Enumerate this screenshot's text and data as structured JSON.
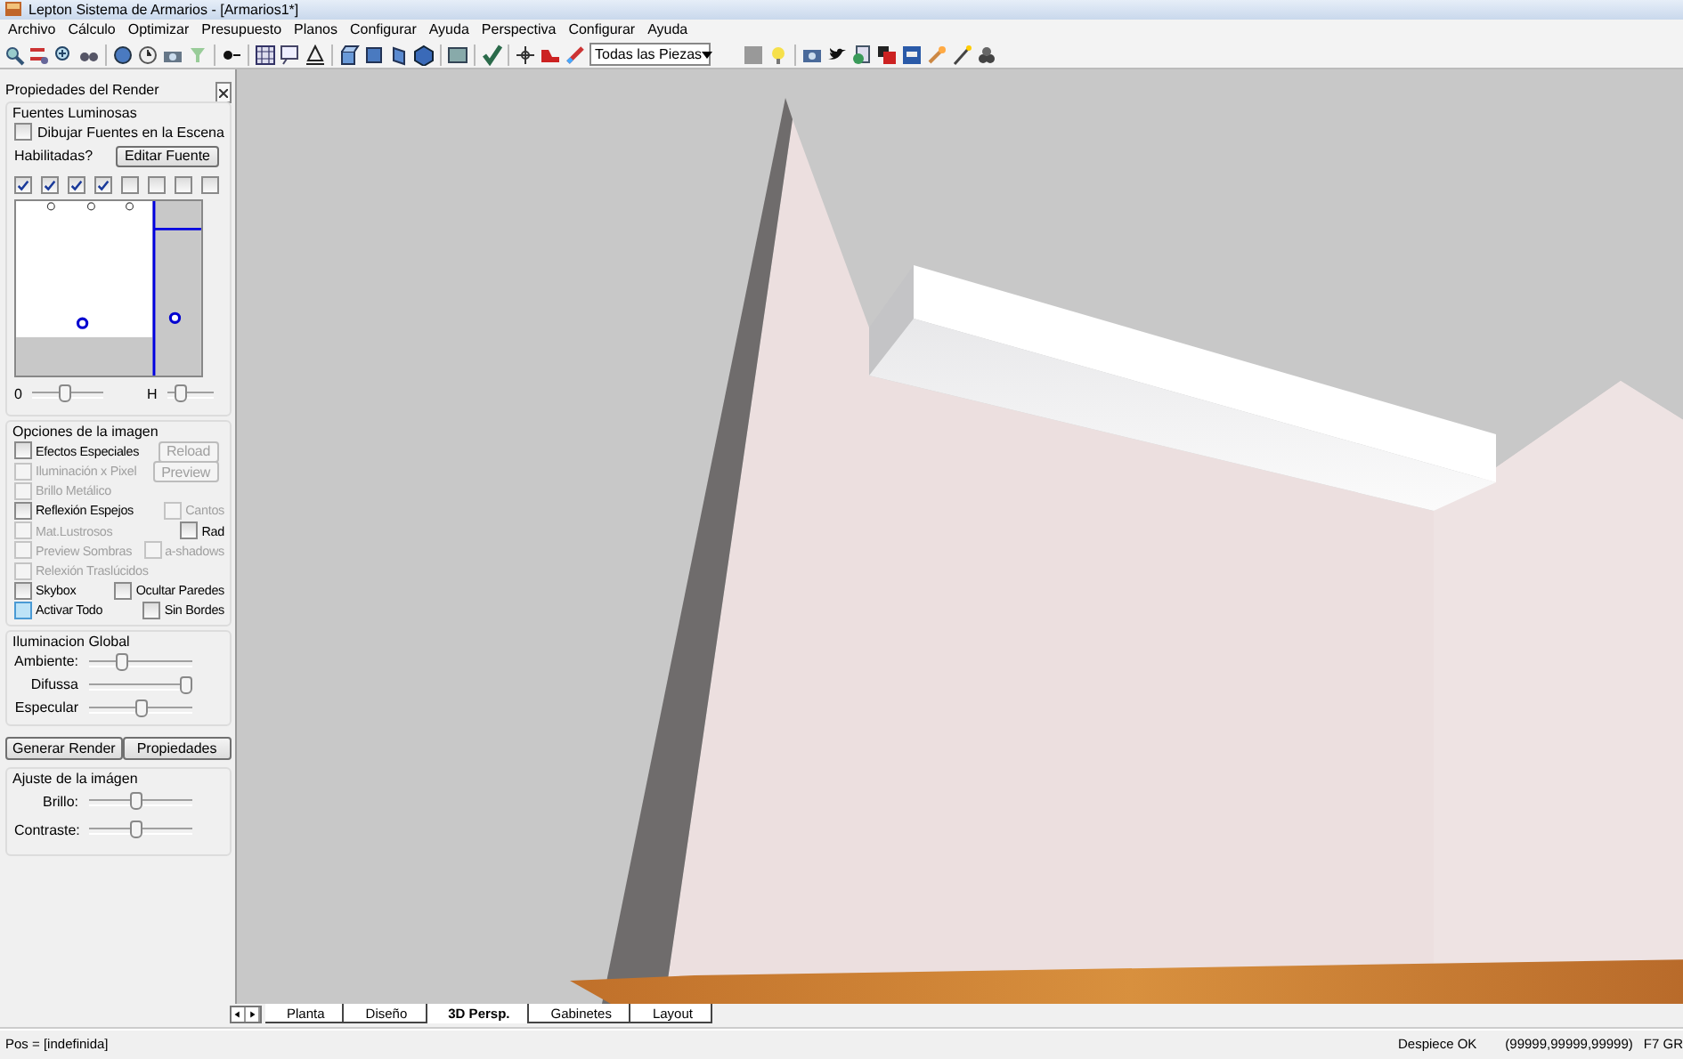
{
  "window": {
    "title": "Lepton Sistema de Armarios - [Armarios1*]"
  },
  "menu": [
    "Archivo",
    "Cálculo",
    "Optimizar",
    "Presupuesto",
    "Planos",
    "Configurar",
    "Ayuda",
    "Perspectiva",
    "Configurar",
    "Ayuda"
  ],
  "toolbar": {
    "pieces_dropdown": {
      "value": "Todas las Piezas"
    }
  },
  "render_panel": {
    "title": "Propiedades del Render",
    "light_sources": {
      "title": "Fuentes Luminosas",
      "draw_in_scene": {
        "label": "Dibujar Fuentes en la Escena",
        "checked": false
      },
      "edit_button": "Editar Fuente",
      "enabled_label": "Habilitadas?",
      "enabled": [
        {
          "checked": true
        },
        {
          "checked": true
        },
        {
          "checked": true
        },
        {
          "checked": true
        },
        {
          "checked": false
        },
        {
          "checked": false
        },
        {
          "checked": false
        },
        {
          "checked": false
        }
      ]
    },
    "sliders": [
      {
        "label": "0",
        "level": 0.45
      },
      {
        "label": "H",
        "level": 0.2
      }
    ],
    "image_options": {
      "title": "Opciones de la imagen",
      "rows": [
        {
          "items": [
            {
              "kind": "checkbox",
              "label": "Efectos Especiales",
              "checked": false,
              "disabled": false,
              "highlighted": false
            },
            {
              "kind": "button",
              "label": "Reload",
              "disabled": true
            }
          ]
        },
        {
          "items": [
            {
              "kind": "checkbox",
              "label": "Iluminación x Pixel",
              "checked": false,
              "disabled": true,
              "highlighted": false
            },
            {
              "kind": "button",
              "label": "Preview",
              "disabled": true
            }
          ]
        },
        {
          "items": [
            {
              "kind": "checkbox",
              "label": "Brillo Metálico",
              "checked": false,
              "disabled": true,
              "highlighted": false
            }
          ]
        },
        {
          "items": [
            {
              "kind": "checkbox",
              "label": "Reflexión Espejos",
              "checked": false,
              "disabled": false,
              "highlighted": false
            },
            {
              "kind": "checkbox",
              "label": "Cantos",
              "checked": false,
              "disabled": true,
              "highlighted": false
            }
          ]
        },
        {
          "items": [
            {
              "kind": "checkbox",
              "label": "Mat.Lustrosos",
              "checked": false,
              "disabled": true,
              "highlighted": false
            },
            {
              "kind": "checkbox",
              "label": "Rad",
              "checked": false,
              "disabled": false,
              "highlighted": false
            }
          ]
        },
        {
          "items": [
            {
              "kind": "checkbox",
              "label": "Preview Sombras",
              "checked": false,
              "disabled": true,
              "highlighted": false
            },
            {
              "kind": "checkbox",
              "label": "a-shadows",
              "checked": false,
              "disabled": true,
              "highlighted": false
            }
          ]
        },
        {
          "items": [
            {
              "kind": "checkbox",
              "label": "Relexión Traslúcidos",
              "checked": false,
              "disabled": true,
              "highlighted": false
            }
          ]
        },
        {
          "items": [
            {
              "kind": "checkbox",
              "label": "Skybox",
              "checked": false,
              "disabled": false,
              "highlighted": false
            },
            {
              "kind": "checkbox",
              "label": "Ocultar Paredes",
              "checked": false,
              "disabled": false,
              "highlighted": false
            }
          ]
        },
        {
          "items": [
            {
              "kind": "checkbox",
              "label": "Activar Todo",
              "checked": false,
              "disabled": false,
              "highlighted": true
            },
            {
              "kind": "checkbox",
              "label": "Sin Bordes",
              "checked": false,
              "disabled": false,
              "highlighted": false
            }
          ]
        }
      ]
    },
    "global_illumination": {
      "title": "Iluminacion Global",
      "sliders": [
        {
          "label": "Ambiente:",
          "level": 0.3
        },
        {
          "label": "Difussa",
          "level": 1.0
        },
        {
          "label": "Especular",
          "level": 0.5
        }
      ]
    },
    "buttons": [
      "Generar Render",
      "Propiedades"
    ],
    "image_adjust": {
      "title": "Ajuste de la imágen",
      "sliders": [
        {
          "label": "Brillo:",
          "level": 0.45
        },
        {
          "label": "Contraste:",
          "level": 0.45
        }
      ]
    }
  },
  "view_tabs": [
    {
      "label": "Planta",
      "selected": false
    },
    {
      "label": "Diseño",
      "selected": false
    },
    {
      "label": "3D Persp.",
      "selected": true
    },
    {
      "label": "Gabinetes",
      "selected": false
    },
    {
      "label": "Layout",
      "selected": false
    }
  ],
  "status_bar": {
    "position": "Pos = [indefinida]",
    "message": "Despiece OK",
    "coordinates": "(99999,99999,99999)",
    "hint": "F7 GR"
  }
}
